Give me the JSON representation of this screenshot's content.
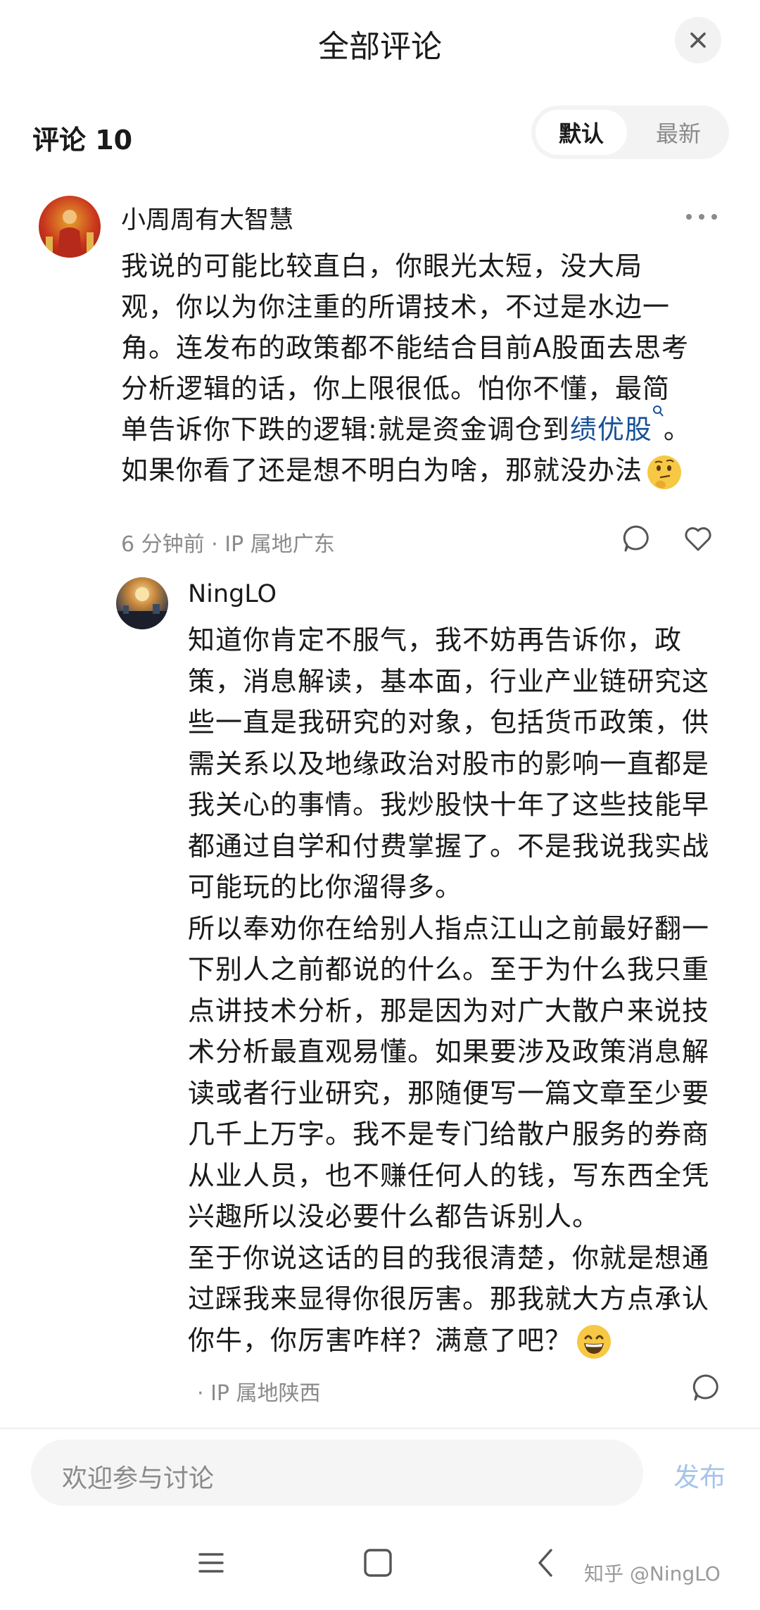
{
  "header": {
    "title": "全部评论",
    "close_icon": "close-icon"
  },
  "comments_bar": {
    "count_label": "评论 10",
    "sort_options": [
      "默认",
      "最新"
    ],
    "active_sort": "默认"
  },
  "comment1": {
    "username": "小周周有大智慧",
    "lines": [
      "我说的可能比较直白，你眼光太短，没大局",
      "观，你以为你注重的所谓技术，不过是水边一",
      "角。连发布的政策都不能结合目前A股面去思考",
      "分析逻辑的话，你上限很低。怕你不懂，最简"
    ],
    "line5_prefix": "单告诉你下跌的逻辑:就是资金调仓到",
    "line5_link": "绩优股",
    "line5_suffix": "。",
    "line6": "如果你看了还是想不明白为啥，那就没办法",
    "time": "6 分钟前",
    "ip": "· IP 属地广东"
  },
  "reply1": {
    "username": "NingLO",
    "lines": [
      "知道你肯定不服气，我不妨再告诉你，政",
      "策，消息解读，基本面，行业产业链研究这",
      "些一直是我研究的对象，包括货币政策，供",
      "需关系以及地缘政治对股市的影响一直都是",
      "我关心的事情。我炒股快十年了这些技能早",
      "都通过自学和付费掌握了。不是我说我实战",
      "可能玩的比你溜得多。",
      "所以奉劝你在给别人指点江山之前最好翻一",
      "下别人之前都说的什么。至于为什么我只重",
      "点讲技术分析，那是因为对广大散户来说技",
      "术分析最直观易懂。如果要涉及政策消息解",
      "读或者行业研究，那随便写一篇文章至少要",
      "几千上万字。我不是专门给散户服务的券商",
      "从业人员，也不赚任何人的钱，写东西全凭",
      "兴趣所以没必要什么都告诉别人。",
      "至于你说这话的目的我很清楚，你就是想通",
      "过踩我来显得你很厉害。那我就大方点承认"
    ],
    "last_line": "你牛，你厉害咋样？满意了吧？",
    "ip": "· IP 属地陕西"
  },
  "input": {
    "placeholder": "欢迎参与讨论",
    "publish": "发布"
  },
  "watermark": "知乎 @NingLO",
  "colors": {
    "link": "#175199",
    "publish_disabled": "#a6c4ea",
    "meta": "#8a8a8a"
  }
}
